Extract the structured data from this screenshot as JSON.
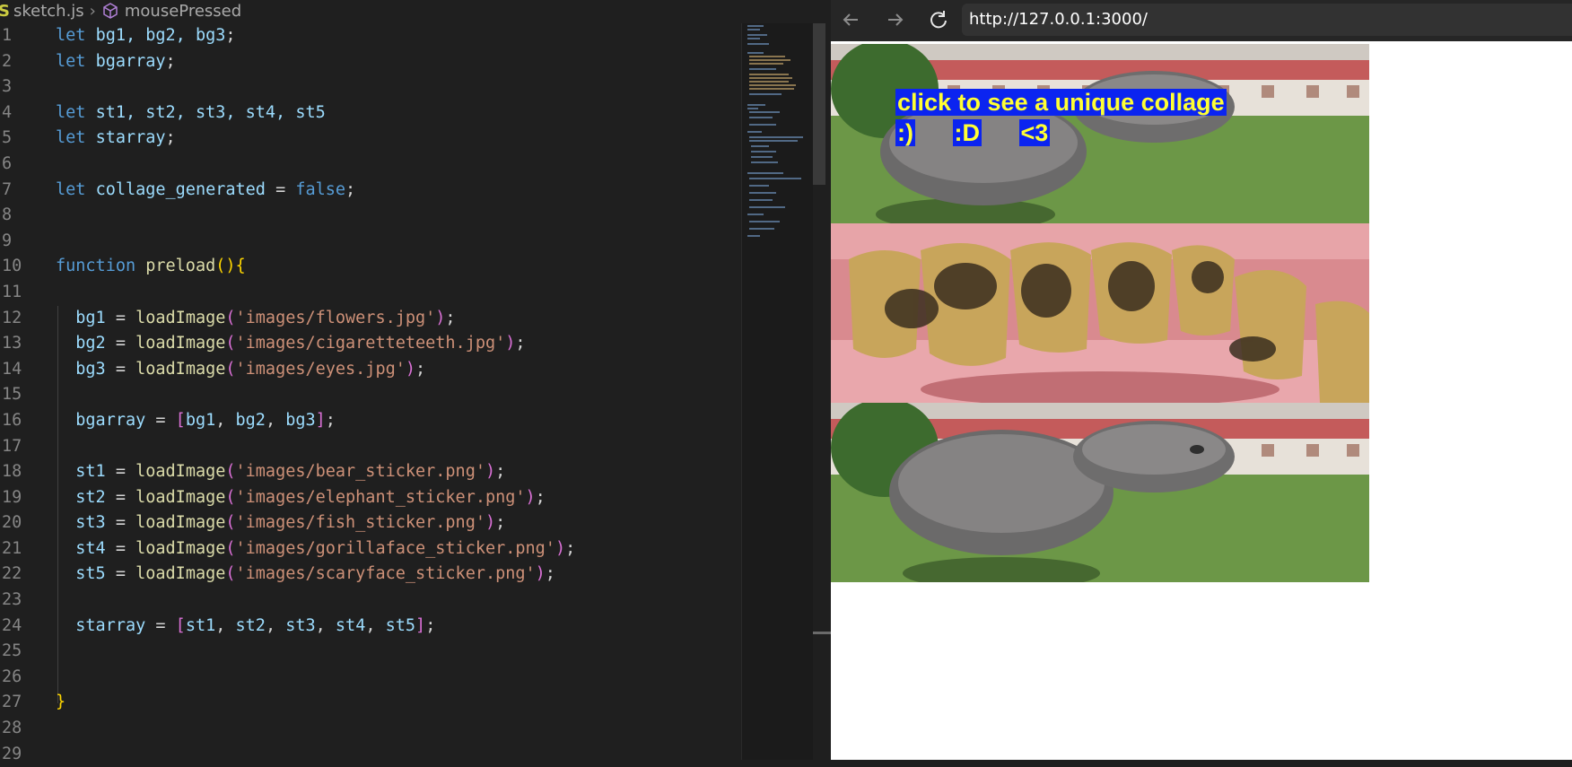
{
  "editor": {
    "breadcrumb": {
      "badge": "S",
      "file": "sketch.js",
      "symbol": "mousePressed"
    },
    "lines": [
      {
        "n": "1"
      },
      {
        "n": "2"
      },
      {
        "n": "3"
      },
      {
        "n": "4"
      },
      {
        "n": "5"
      },
      {
        "n": "6"
      },
      {
        "n": "7"
      },
      {
        "n": "8"
      },
      {
        "n": "9"
      },
      {
        "n": "10"
      },
      {
        "n": "11"
      },
      {
        "n": "12"
      },
      {
        "n": "13"
      },
      {
        "n": "14"
      },
      {
        "n": "15"
      },
      {
        "n": "16"
      },
      {
        "n": "17"
      },
      {
        "n": "18"
      },
      {
        "n": "19"
      },
      {
        "n": "20"
      },
      {
        "n": "21"
      },
      {
        "n": "22"
      },
      {
        "n": "23"
      },
      {
        "n": "24"
      },
      {
        "n": "25"
      },
      {
        "n": "26"
      },
      {
        "n": "27"
      },
      {
        "n": "28"
      },
      {
        "n": "29"
      }
    ],
    "code": {
      "kw_let": "let",
      "l1_vars": "bg1, bg2, bg3",
      "l2_var": "bgarray",
      "l4_vars": "st1, st2, st3, st4, st5",
      "l5_var": "starray",
      "l7_var": "collage_generated",
      "l7_val": "false",
      "kw_function": "function",
      "fn_preload": "preload",
      "fn_loadImage": "loadImage",
      "bg1": "bg1",
      "bg2": "bg2",
      "bg3": "bg3",
      "st1": "st1",
      "st2": "st2",
      "st3": "st3",
      "st4": "st4",
      "st5": "st5",
      "path_bg1": "'images/flowers.jpg'",
      "path_bg2": "'images/cigaretteteeth.jpg'",
      "path_bg3": "'images/eyes.jpg'",
      "path_st1": "'images/bear_sticker.png'",
      "path_st2": "'images/elephant_sticker.png'",
      "path_st3": "'images/fish_sticker.png'",
      "path_st4": "'images/gorillaface_sticker.png'",
      "path_st5": "'images/scaryface_sticker.png'"
    }
  },
  "browser": {
    "url": "http://127.0.0.1:3000/",
    "banner_line1": "click to see a unique collage",
    "banner_faces": [
      ":)",
      ":D",
      "<3"
    ]
  },
  "colors": {
    "editor_bg": "#1f1f1f",
    "keyword": "#569cd6",
    "variable": "#9cdcfe",
    "function": "#dcdcaa",
    "string": "#ce9178",
    "banner_text": "#ffff33",
    "banner_highlight": "#0b24f0"
  },
  "icons": {
    "breadcrumb_symbol": "cube-icon",
    "back": "arrow-left-icon",
    "forward": "arrow-right-icon",
    "reload": "reload-icon"
  }
}
